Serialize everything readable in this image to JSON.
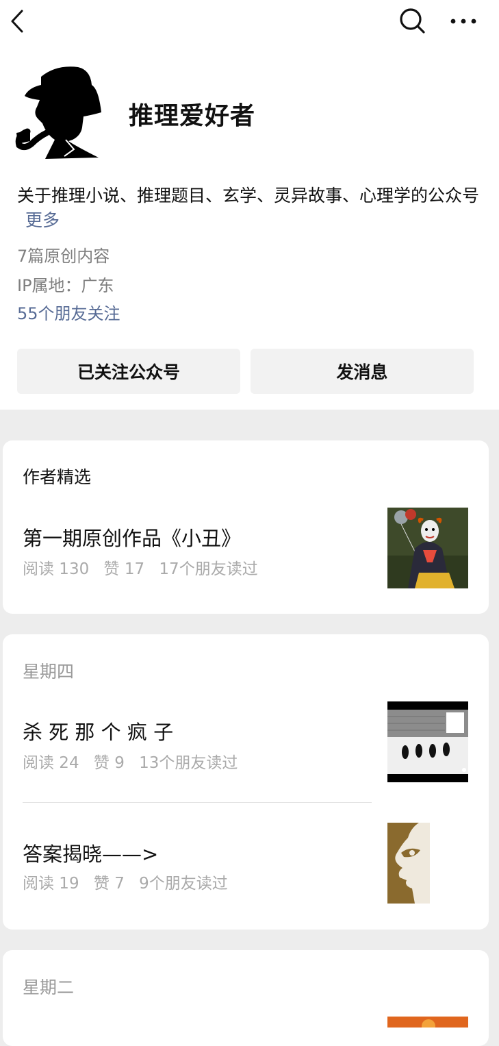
{
  "nav": {
    "back_icon": "back-arrow",
    "search_icon": "search",
    "more_icon": "more-dots"
  },
  "account": {
    "name": "推理爱好者",
    "description": "关于推理小说、推理题目、玄学、灵异故事、心理学的公众号",
    "more_link": "更多",
    "original_count": "7篇原创内容",
    "ip_location": "IP属地：广东",
    "friends_following": "55个朋友关注"
  },
  "actions": {
    "follow_label": "已关注公众号",
    "message_label": "发消息"
  },
  "featured": {
    "title": "作者精选",
    "articles": [
      {
        "title": "第一期原创作品《小丑》",
        "reads": "阅读 130",
        "likes": "赞 17",
        "friends": "17个朋友读过"
      }
    ]
  },
  "groups": [
    {
      "day": "星期四",
      "articles": [
        {
          "title": "杀 死 那 个 疯 子",
          "reads": "阅读 24",
          "likes": "赞 9",
          "friends": "13个朋友读过"
        },
        {
          "title": "答案揭晓——>",
          "reads": "阅读 19",
          "likes": "赞 7",
          "friends": "9个朋友读过"
        }
      ]
    },
    {
      "day": "星期二",
      "articles": []
    }
  ],
  "colors": {
    "link": "#576b95",
    "muted": "#999999",
    "background": "#ededed",
    "button": "#f2f2f2"
  }
}
